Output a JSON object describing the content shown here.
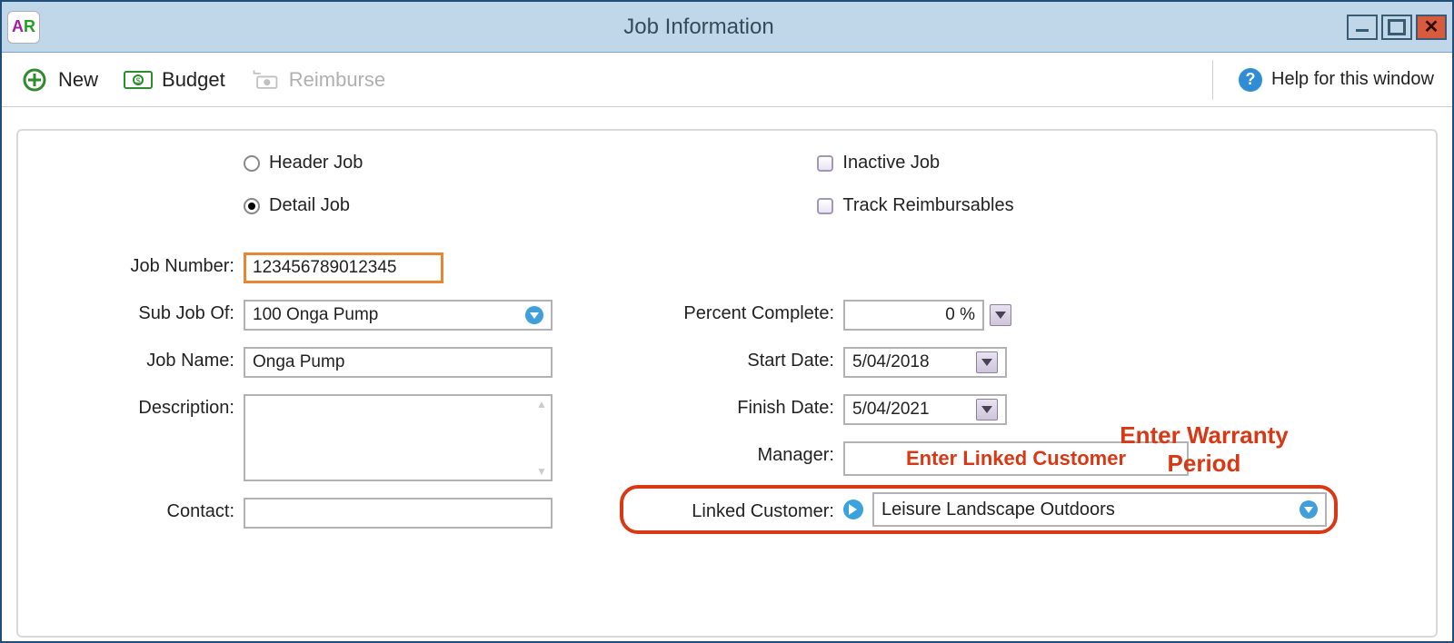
{
  "titlebar": {
    "app_initials_a": "A",
    "app_initials_r": "R",
    "title": "Job Information"
  },
  "toolbar": {
    "new_label": "New",
    "budget_label": "Budget",
    "reimburse_label": "Reimburse",
    "help_label": "Help for this window"
  },
  "top_options": {
    "header_job_label": "Header Job",
    "detail_job_label": "Detail Job",
    "inactive_label": "Inactive Job",
    "track_label": "Track Reimbursables"
  },
  "fields": {
    "job_number_label": "Job Number:",
    "job_number_value": "123456789012345",
    "sub_job_label": "Sub Job Of:",
    "sub_job_value": "100 Onga Pump",
    "job_name_label": "Job Name:",
    "job_name_value": "Onga Pump",
    "description_label": "Description:",
    "description_value": "",
    "contact_label": "Contact:",
    "contact_value": "",
    "pct_label": "Percent Complete:",
    "pct_value": "0 %",
    "start_label": "Start Date:",
    "start_value": "5/04/2018",
    "finish_label": "Finish Date:",
    "finish_value": "5/04/2021",
    "manager_label": "Manager:",
    "linked_label": "Linked Customer:",
    "linked_value": "Leisure Landscape Outdoors"
  },
  "annotations": {
    "warranty": "Enter Warranty Period",
    "linked_customer": "Enter Linked Customer"
  }
}
